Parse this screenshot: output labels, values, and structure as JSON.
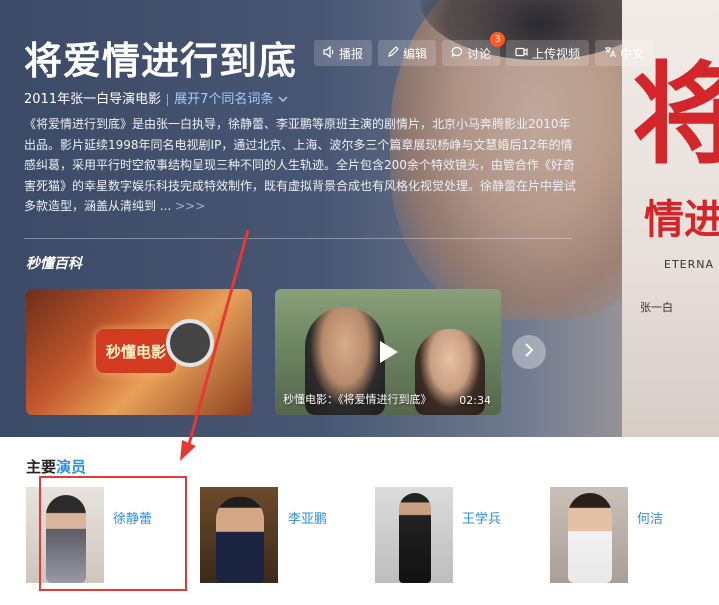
{
  "hero": {
    "title": "将爱情进行到底",
    "subtitle": "2011年张一白导演电影",
    "homonym_link": "展开7个同名词条",
    "description": "《将爱情进行到底》是由张一白执导，徐静蕾、李亚鹏等原班主演的剧情片，北京小马奔腾影业2010年出品。影片延续1998年同名电视剧IP，通过北京、上海、波尔多三个篇章展现杨峥与文慧婚后12年的情感纠葛，采用平行时空叙事结构呈现三种不同的人生轨迹。全片包含200余个特效镜头，由管合作《好奇害死猫》的幸星数字娱乐科技完成特效制作，既有虚拟背景合成也有风格化视觉处理。徐静蕾在片中尝试多款造型，涵盖从清纯到 ...",
    "more_label": ">>>",
    "brand": "秒懂百科"
  },
  "toolbar": {
    "items": [
      {
        "icon": "speaker-icon",
        "label": "播报"
      },
      {
        "icon": "pencil-icon",
        "label": "编辑"
      },
      {
        "icon": "chat-bubble-icon",
        "label": "讨论",
        "badge": "3"
      },
      {
        "icon": "video-upload-icon",
        "label": "上传视频"
      },
      {
        "icon": "translate-icon",
        "label": "中文"
      }
    ]
  },
  "poster": {
    "big_char": "将",
    "sub": "情进行",
    "english": "ETERNA",
    "credit": "张一白"
  },
  "videos": {
    "thumb1_logo": "秒懂电影",
    "thumb2_caption": "秒懂电影：《将爱情进行到底》",
    "thumb2_duration": "02:34",
    "play_icon": "play-icon",
    "next_icon": "chevron-right-icon"
  },
  "cast": {
    "title_prefix": "主要",
    "title_accent": "演员",
    "actors": [
      {
        "name": "徐静蕾"
      },
      {
        "name": "李亚鹏"
      },
      {
        "name": "王学兵"
      },
      {
        "name": "何洁"
      }
    ]
  },
  "annotation": {
    "highlight_color": "#e53935"
  },
  "colors": {
    "accent_link": "#2b8fe4",
    "badge": "#ff5a2a",
    "poster_red": "#d3262b"
  }
}
